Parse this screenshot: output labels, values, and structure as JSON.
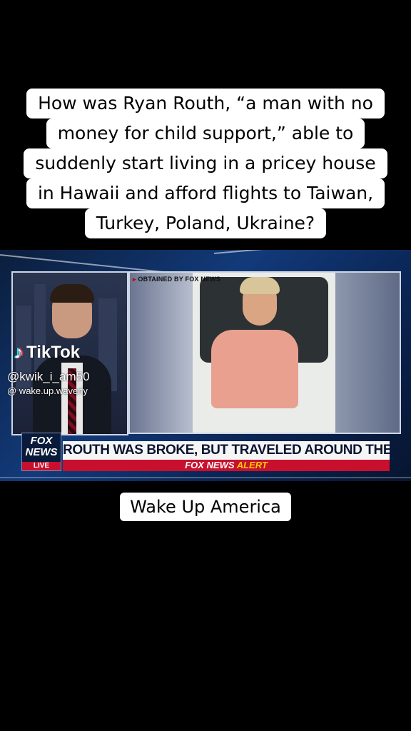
{
  "caption": {
    "lines": [
      "How was Ryan Routh, “a man with no",
      "money for child support,” able to",
      "suddenly start living in a pricey house",
      "in Hawaii and afford flights to Taiwan,",
      "Turkey, Poland, Ukraine?"
    ]
  },
  "video": {
    "photo_credit_mark": "▸",
    "photo_credit": "OBTAINED BY FOX NEWS",
    "watermark": {
      "brand": "TikTok",
      "icon": "tiktok-note-icon",
      "username": "@kwik_i_am50",
      "handle": "@ wake.up.waverly"
    },
    "logo": {
      "line1": "FOX",
      "line2": "NEWS",
      "live": "LIVE"
    },
    "chyron": "ROUTH WAS BROKE, BUT TRAVELED AROUND THE WORLD",
    "alert": {
      "part1": "FOX NEWS",
      "part2": "ALERT"
    }
  },
  "bottom_caption": "Wake Up America",
  "colors": {
    "caption_bg": "#ffffff",
    "fox_red": "#c8102e",
    "alert_yellow": "#ffcc00",
    "navy": "#0b1530"
  }
}
